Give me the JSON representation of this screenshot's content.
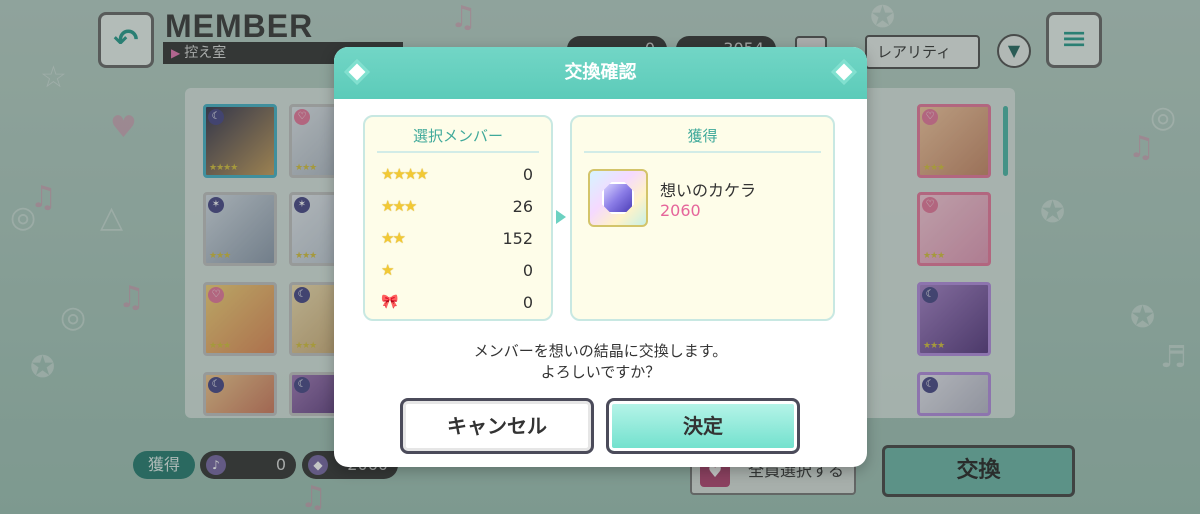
{
  "header": {
    "title": "MEMBER",
    "subtitle": "控え室",
    "currency_1": "0",
    "currency_2": "3054",
    "rarity_select": "レアリティ"
  },
  "bottom": {
    "gain_label": "獲得",
    "gain_value_1": "0",
    "gain_value_2": "2060",
    "select_all": "全員選択する",
    "exchange": "交換"
  },
  "dialog": {
    "title": "交換確認",
    "selected_title": "選択メンバー",
    "gain_title": "獲得",
    "rarity_counts": [
      {
        "rarity": "4star",
        "stars": "★★★★",
        "count": "0"
      },
      {
        "rarity": "3star",
        "stars": "★★★",
        "count": "26"
      },
      {
        "rarity": "2star",
        "stars": "★★",
        "count": "152"
      },
      {
        "rarity": "1star",
        "stars": "★",
        "count": "0"
      },
      {
        "rarity": "birthday",
        "stars": "🎀",
        "count": "0"
      }
    ],
    "gain_item_name": "想いのカケラ",
    "gain_item_value": "2060",
    "message_line1": "メンバーを想いの結晶に交換します。",
    "message_line2": "よろしいですか？",
    "cancel_label": "キャンセル",
    "ok_label": "決定"
  },
  "colors": {
    "accent": "#5ccbb9",
    "gain_value": "#e5659b",
    "panel_bg": "#fefde9"
  }
}
